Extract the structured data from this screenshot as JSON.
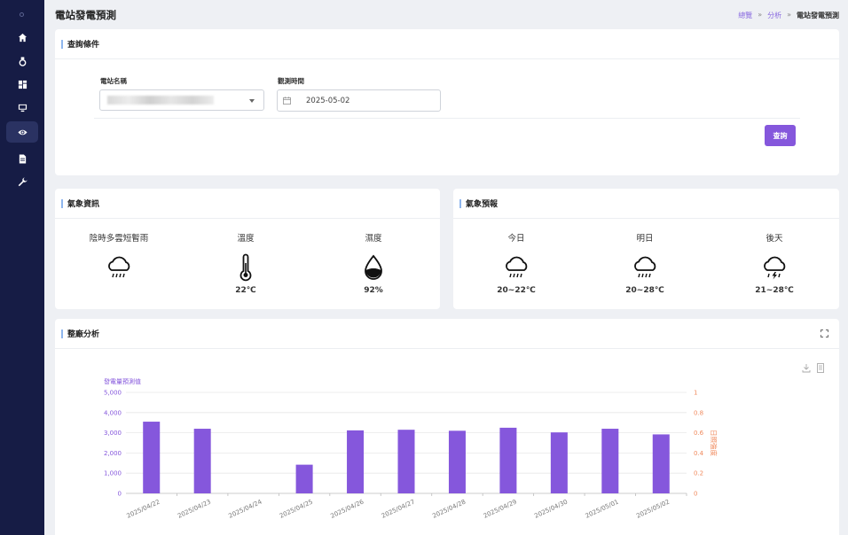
{
  "page": {
    "title": "電站發電預測",
    "breadcrumb": [
      "總覽",
      "分析",
      "電站發電預測"
    ],
    "breadcrumb_sep": "»"
  },
  "sidebar": {
    "items": [
      {
        "icon": "home-icon"
      },
      {
        "icon": "medal-icon"
      },
      {
        "icon": "dashboard-icon"
      },
      {
        "icon": "monitor-icon"
      },
      {
        "icon": "eye-icon",
        "active": true
      },
      {
        "icon": "document-icon"
      },
      {
        "icon": "wrench-icon"
      }
    ]
  },
  "query": {
    "title": "查詢條件",
    "station_label": "電站名稱",
    "date_label": "觀測時間",
    "date_value": "2025-05-02",
    "button": "查詢"
  },
  "weather_info": {
    "title": "氣象資訊",
    "columns": [
      {
        "label": "陰時多雲短暫雨",
        "icon": "rain-cloud-icon",
        "value": ""
      },
      {
        "label": "溫度",
        "icon": "thermometer-icon",
        "value": "22℃"
      },
      {
        "label": "濕度",
        "icon": "water-drop-icon",
        "value": "92%"
      }
    ]
  },
  "forecast": {
    "title": "氣象預報",
    "columns": [
      {
        "label": "今日",
        "icon": "rain-cloud-icon",
        "value": "20~22℃"
      },
      {
        "label": "明日",
        "icon": "rain-cloud-icon",
        "value": "20~28℃"
      },
      {
        "label": "後天",
        "icon": "thunder-cloud-icon",
        "value": "21~28℃"
      }
    ]
  },
  "analysis": {
    "title": "整廠分析"
  },
  "colors": {
    "accent": "#8557dc",
    "sidebar": "#161c45",
    "right_axis": "#f08a5d"
  },
  "chart_data": {
    "type": "bar",
    "categories": [
      "2025/04/22",
      "2025/04/23",
      "2025/04/24",
      "2025/04/25",
      "2025/04/26",
      "2025/04/27",
      "2025/04/28",
      "2025/04/29",
      "2025/04/30",
      "2025/05/01",
      "2025/05/02"
    ],
    "series": [
      {
        "name": "發電量預測值",
        "values": [
          3550,
          3200,
          0,
          1420,
          3120,
          3150,
          3100,
          3250,
          3020,
          3200,
          2920
        ]
      }
    ],
    "ylabel": "發電量預測值",
    "ylabel_right": "日照強度",
    "ylim": [
      0,
      5000
    ],
    "y_ticks": [
      "0",
      "1,000",
      "2,000",
      "3,000",
      "4,000",
      "5,000"
    ],
    "ylim_right": [
      0,
      1
    ],
    "y_ticks_right": [
      "0",
      "0.2",
      "0.4",
      "0.6",
      "0.8",
      "1"
    ],
    "grid": true
  }
}
